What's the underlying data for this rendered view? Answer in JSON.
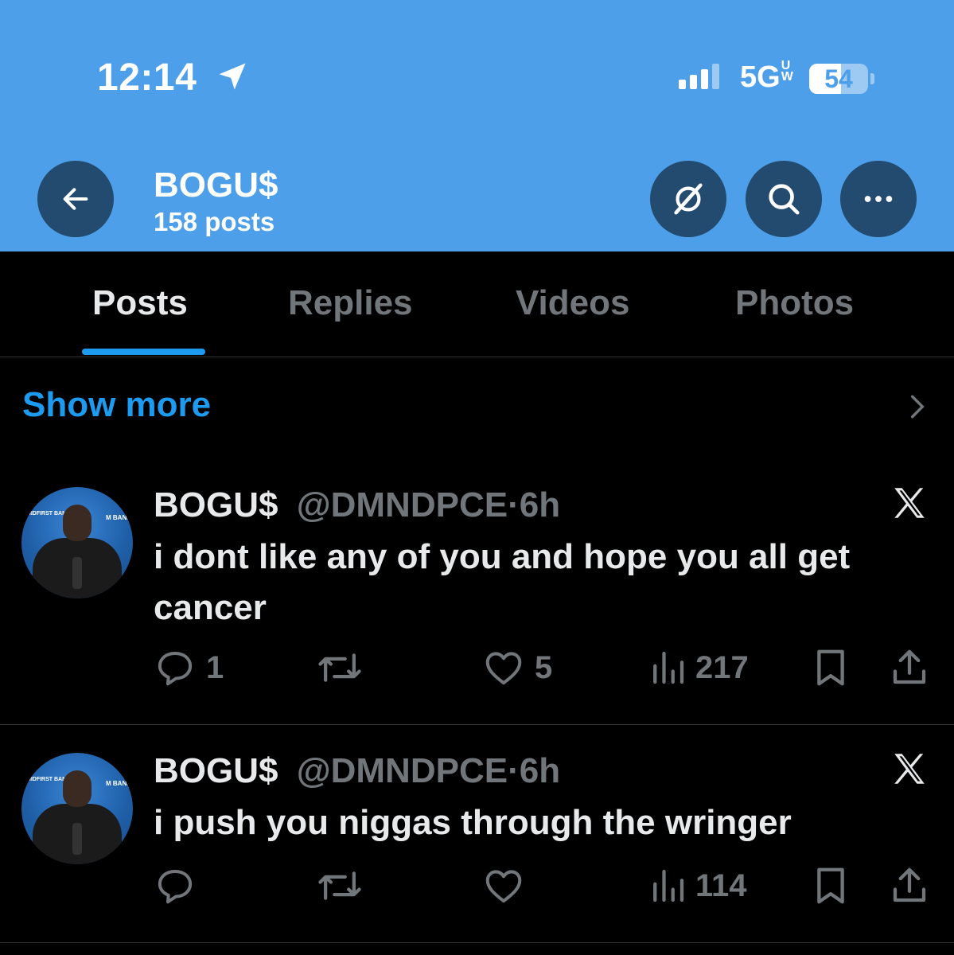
{
  "status_bar": {
    "time": "12:14",
    "network": "5G",
    "network_suffix": "UW",
    "battery_percent": "54",
    "battery_level": 0.54,
    "signal_bars_active": 3
  },
  "header": {
    "profile_name": "BOGU$",
    "post_count": "158 posts",
    "back_icon": "arrow-left-icon",
    "grok_icon": "grok-slash-circle-icon",
    "search_icon": "search-icon",
    "more_icon": "ellipsis-icon"
  },
  "tabs": [
    {
      "label": "Posts",
      "active": true
    },
    {
      "label": "Replies",
      "active": false
    },
    {
      "label": "Videos",
      "active": false
    },
    {
      "label": "Photos",
      "active": false
    }
  ],
  "show_more": {
    "label": "Show more"
  },
  "posts": [
    {
      "name": "BOGU$",
      "handle": "@DMNDPCE",
      "separator": "·",
      "time": "6h",
      "text": "i dont like any of you and hope you all get cancer",
      "replies": "1",
      "reposts": "",
      "likes": "5",
      "views": "217",
      "avatar_logo_left": "MIDFIRST BANK",
      "avatar_logo_right": "M BANK"
    },
    {
      "name": "BOGU$",
      "handle": "@DMNDPCE",
      "separator": "·",
      "time": "6h",
      "text": "i push you niggas through the wringer",
      "replies": "",
      "reposts": "",
      "likes": "",
      "views": "114",
      "avatar_logo_left": "MIDFIRST BANK",
      "avatar_logo_right": "M BANK"
    }
  ],
  "colors": {
    "header_bg": "#4c9fe8",
    "header_button_bg": "#234b70",
    "accent": "#1d9bf0",
    "text_primary": "#e7e9ea",
    "text_secondary": "#71767b",
    "background": "#000000"
  }
}
